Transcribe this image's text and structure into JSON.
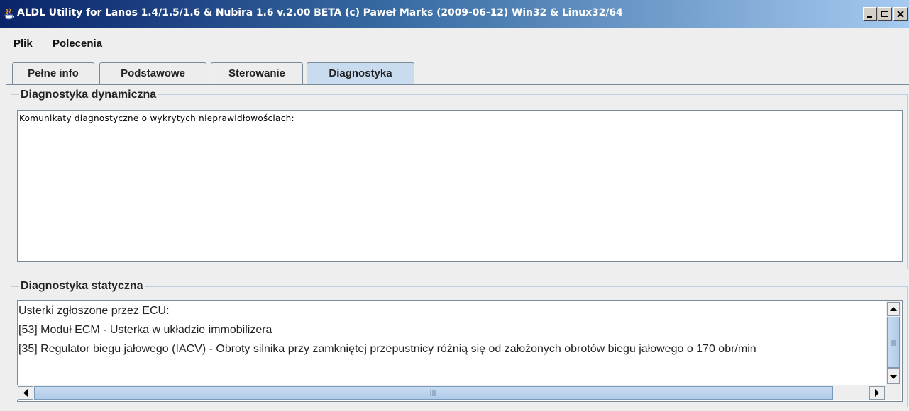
{
  "window": {
    "title": "ALDL Utility for Lanos 1.4/1.5/1.6 & Nubira 1.6  v.2.00 BETA (c) Paweł Marks (2009-06-12) Win32 & Linux32/64",
    "icon": "java-cup-icon",
    "controls": [
      "minimize-icon",
      "maximize-icon",
      "close-icon"
    ]
  },
  "menu": {
    "items": [
      "Plik",
      "Polecenia"
    ]
  },
  "tabs": {
    "items": [
      "Pełne info",
      "Podstawowe",
      "Sterowanie",
      "Diagnostyka"
    ],
    "active": "Diagnostyka"
  },
  "dynamic": {
    "title": "Diagnostyka dynamiczna",
    "text": "Komunikaty diagnostyczne o wykrytych nieprawidłowościach:"
  },
  "static": {
    "title": "Diagnostyka statyczna",
    "lines": [
      "Usterki zgłoszone przez ECU:",
      "[53] Moduł ECM - Usterka w układzie immobilizera",
      "[35] Regulator biegu jałowego (IACV) - Obroty silnika przy zamkniętej przepustnicy różnią się od założonych obrotów biegu jałowego o 170 obr/min"
    ]
  },
  "colors": {
    "title_bar": "#0a246a",
    "active_tab": "#c9dbef",
    "scroll_thumb": "#b8d0ea"
  }
}
